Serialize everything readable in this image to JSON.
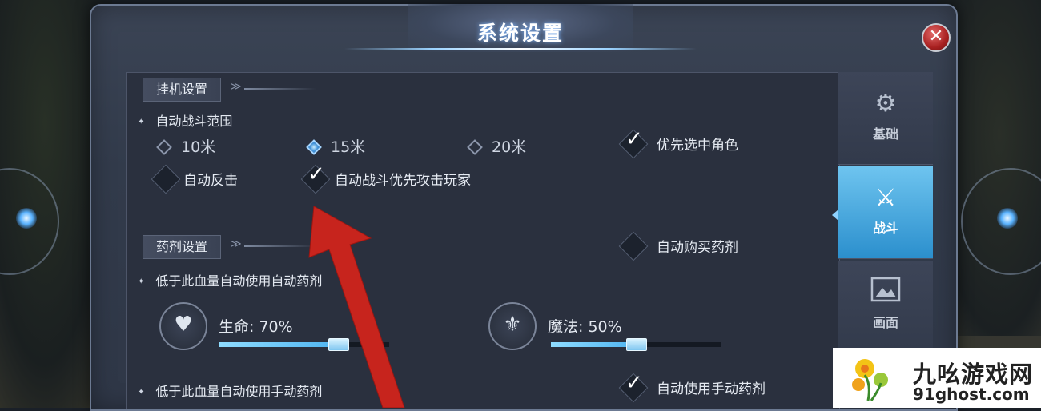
{
  "window": {
    "title": "系统设置",
    "close_glyph": "✕"
  },
  "tabs": [
    {
      "label": "基础",
      "icon": "gear-icon",
      "active": false
    },
    {
      "label": "战斗",
      "icon": "sword-shield-icon",
      "active": true
    },
    {
      "label": "画面",
      "icon": "image-icon",
      "active": false
    }
  ],
  "idle": {
    "section_label": "挂机设置",
    "range_label": "自动战斗范围",
    "range_options": [
      "10米",
      "15米",
      "20米"
    ],
    "range_selected": "15米",
    "prefer_role": {
      "label": "优先选中角色",
      "checked": true
    },
    "auto_counter": {
      "label": "自动反击",
      "checked": false
    },
    "attack_player_first": {
      "label": "自动战斗优先攻击玩家",
      "checked": true
    }
  },
  "potion": {
    "section_label": "药剂设置",
    "auto_buy": {
      "label": "自动购买药剂",
      "checked": false
    },
    "auto_use_label": "低于此血量自动使用自动药剂",
    "hp": {
      "label": "生命:",
      "value_text": "70%",
      "percent": 70
    },
    "mp": {
      "label": "魔法:",
      "value_text": "50%",
      "percent": 50
    },
    "manual_use_label": "低于此血量自动使用手动药剂",
    "manual_auto_use": {
      "label": "自动使用手动药剂",
      "checked": true
    }
  },
  "watermark": {
    "name": "九吆游戏网",
    "url": "91ghost.com"
  },
  "colors": {
    "accent": "#3fa6e6",
    "panel": "#323b4b",
    "arrow": "#c7241d"
  }
}
